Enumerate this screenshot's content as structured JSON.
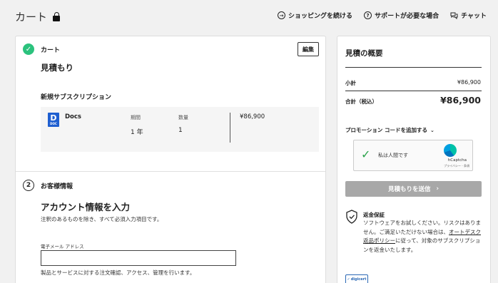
{
  "header": {
    "title": "カート",
    "links": [
      {
        "icon": "arrow-right-circle-icon",
        "symbol": "→",
        "label": "ショッピングを続ける"
      },
      {
        "icon": "help-circle-icon",
        "symbol": "?",
        "label": "サポートが必要な場合"
      },
      {
        "icon": "chat-icon",
        "symbol": "",
        "label": "チャット"
      }
    ]
  },
  "cart_section": {
    "label": "カート",
    "edit_label": "編集",
    "quote_title": "見積もり",
    "subscription_heading": "新規サブスクリプション",
    "product": {
      "icon_letter": "D",
      "icon_sub": "DOC",
      "name": "Docs",
      "period_label": "期間",
      "period_value": "1 年",
      "qty_label": "数量",
      "qty_value": "1",
      "price": "¥86,900"
    }
  },
  "customer_section": {
    "step": "2",
    "label": "お客様情報",
    "account_title": "アカウント情報を入力",
    "required_note": "注釈のあるものを除き、すべて必須入力項目です。",
    "email_label": "電子メール アドレス",
    "email_value": "",
    "email_help": "製品とサービスに対する注文確認、アクセス、管理を行います。"
  },
  "summary": {
    "title": "見積の概要",
    "subtotal_label": "小計",
    "subtotal_value": "¥86,900",
    "total_label": "合計（税込）",
    "total_value": "¥86,900",
    "promo_label": "プロモーション コードを追加する",
    "captcha": {
      "text": "私は人間です",
      "brand": "hCaptcha",
      "links": "プライバシー - 条項"
    },
    "send_label": "見積もりを送信",
    "refund_title": "返金保証",
    "refund_text_before": "ソフトウェアをお試しください。リスクはありません。ご満足いただけない場合は、",
    "refund_link": "オートデスク返品ポリシー",
    "refund_text_after": "に従って、対象のサブスクリプションを返金いたします。",
    "digicert_label": "digicert"
  }
}
